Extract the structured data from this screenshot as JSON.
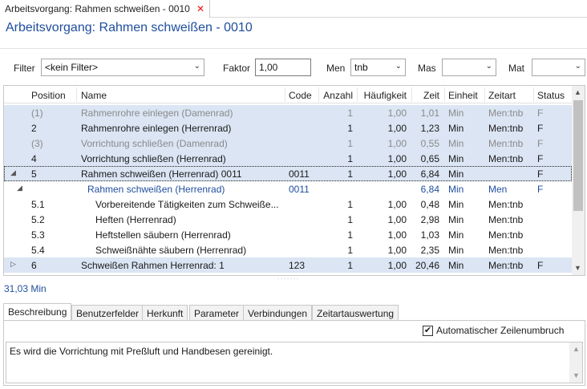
{
  "tab": {
    "title": "Arbeitsvorgang: Rahmen schweißen - 0010",
    "close_glyph": "✕"
  },
  "page_title": "Arbeitsvorgang: Rahmen schweißen - 0010",
  "filterbar": {
    "filter_label": "Filter",
    "filter_value": "<kein Filter>",
    "faktor_label": "Faktor",
    "faktor_value": "1,00",
    "men_label": "Men",
    "men_value": "tnb",
    "mas_label": "Mas",
    "mas_value": "",
    "mat_label": "Mat",
    "mat_value": ""
  },
  "grid": {
    "headers": {
      "position": "Position",
      "name": "Name",
      "code": "Code",
      "anzahl": "Anzahl",
      "haeufigkeit": "Häufigkeit",
      "zeit": "Zeit",
      "einheit": "Einheit",
      "zeitart": "Zeitart",
      "status": "Status"
    },
    "rows": [
      {
        "position": "(1)",
        "name": "Rahmenrohre einlegen (Damenrad)",
        "code": "",
        "anzahl": "1",
        "haeufigkeit": "1,00",
        "zeit": "1,01",
        "einheit": "Min",
        "zeitart": "Men:tnb",
        "status": "F"
      },
      {
        "position": "2",
        "name": "Rahmenrohre einlegen (Herrenrad)",
        "code": "",
        "anzahl": "1",
        "haeufigkeit": "1,00",
        "zeit": "1,23",
        "einheit": "Min",
        "zeitart": "Men:tnb",
        "status": "F"
      },
      {
        "position": "(3)",
        "name": "Vorrichtung schließen (Damenrad)",
        "code": "",
        "anzahl": "1",
        "haeufigkeit": "1,00",
        "zeit": "0,55",
        "einheit": "Min",
        "zeitart": "Men:tnb",
        "status": "F"
      },
      {
        "position": "4",
        "name": "Vorrichtung schließen (Herrenrad)",
        "code": "",
        "anzahl": "1",
        "haeufigkeit": "1,00",
        "zeit": "0,65",
        "einheit": "Min",
        "zeitart": "Men:tnb",
        "status": "F"
      },
      {
        "position": "5",
        "name": "Rahmen schweißen (Herrenrad) 0011",
        "code": "0011",
        "anzahl": "1",
        "haeufigkeit": "1,00",
        "zeit": "6,84",
        "einheit": "Min",
        "zeitart": "",
        "status": "F"
      },
      {
        "position": "",
        "name": "Rahmen schweißen (Herrenrad)",
        "code": "0011",
        "anzahl": "",
        "haeufigkeit": "",
        "zeit": "6,84",
        "einheit": "Min",
        "zeitart": "Men",
        "status": "F"
      },
      {
        "position": "5.1",
        "name": "Vorbereitende Tätigkeiten zum Schweiße...",
        "code": "",
        "anzahl": "1",
        "haeufigkeit": "1,00",
        "zeit": "0,48",
        "einheit": "Min",
        "zeitart": "Men:tnb",
        "status": ""
      },
      {
        "position": "5.2",
        "name": "Heften (Herrenrad)",
        "code": "",
        "anzahl": "1",
        "haeufigkeit": "1,00",
        "zeit": "2,98",
        "einheit": "Min",
        "zeitart": "Men:tnb",
        "status": ""
      },
      {
        "position": "5.3",
        "name": "Heftstellen säubern (Herrenrad)",
        "code": "",
        "anzahl": "1",
        "haeufigkeit": "1,00",
        "zeit": "1,03",
        "einheit": "Min",
        "zeitart": "Men:tnb",
        "status": ""
      },
      {
        "position": "5.4",
        "name": "Schweißnähte säubern (Herrenrad)",
        "code": "",
        "anzahl": "1",
        "haeufigkeit": "1,00",
        "zeit": "2,35",
        "einheit": "Min",
        "zeitart": "Men:tnb",
        "status": ""
      },
      {
        "position": "6",
        "name": "Schweißen Rahmen Herrenrad: 1",
        "code": "123",
        "anzahl": "1",
        "haeufigkeit": "1,00",
        "zeit": "20,46",
        "einheit": "Min",
        "zeitart": "Men:tnb",
        "status": "F"
      }
    ]
  },
  "total": "31,03 Min",
  "bottom_tabs": [
    "Beschreibung",
    "Benutzerfelder",
    "Herkunft",
    "Parameter",
    "Verbindungen",
    "Zeitartauswertung"
  ],
  "wrap_checkbox": {
    "label": "Automatischer Zeilenumbruch",
    "checked": "✔"
  },
  "description": "Es wird die Vorrichtung mit Preßluft und Handbesen gereinigt.",
  "icons": {
    "expand_open": "◢",
    "expand_closed": "▷",
    "dropdown": "⌄",
    "scroll_up": "▲",
    "scroll_down": "▼",
    "grip": "˙˙˙˙˙˙˙"
  },
  "colors": {
    "accent": "#1f4e9e",
    "row_highlight": "#dbe5f4",
    "close": "#e11111"
  }
}
